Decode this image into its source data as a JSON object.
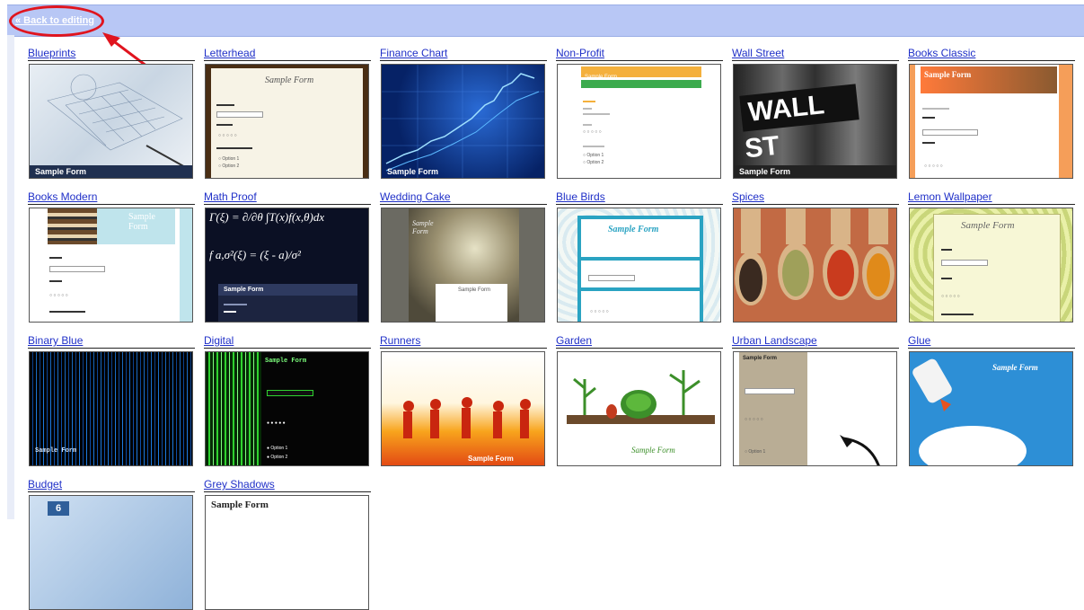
{
  "header": {
    "back_link": "« Back to editing"
  },
  "sample_label": "Sample Form",
  "themes": [
    "Blueprints",
    "Letterhead",
    "Finance Chart",
    "Non-Profit",
    "Wall Street",
    "Books Classic",
    "Books Modern",
    "Math Proof",
    "Wedding Cake",
    "Blue Birds",
    "Spices",
    "Lemon Wallpaper",
    "Binary Blue",
    "Digital",
    "Runners",
    "Garden",
    "Urban Landscape",
    "Glue",
    "Budget",
    "Grey Shadows"
  ],
  "wall_sign": "WALL ST",
  "math_formula_1": "Γ(ξ) = ∂/∂θ ∫T(x)f(x,θ)dx",
  "math_formula_2": "f a,σ²(ξ) = (ξ - a)/σ²",
  "colors": {
    "link": "#2030c8",
    "header_bg": "#b8c7f5",
    "annotation": "#e0141e"
  }
}
